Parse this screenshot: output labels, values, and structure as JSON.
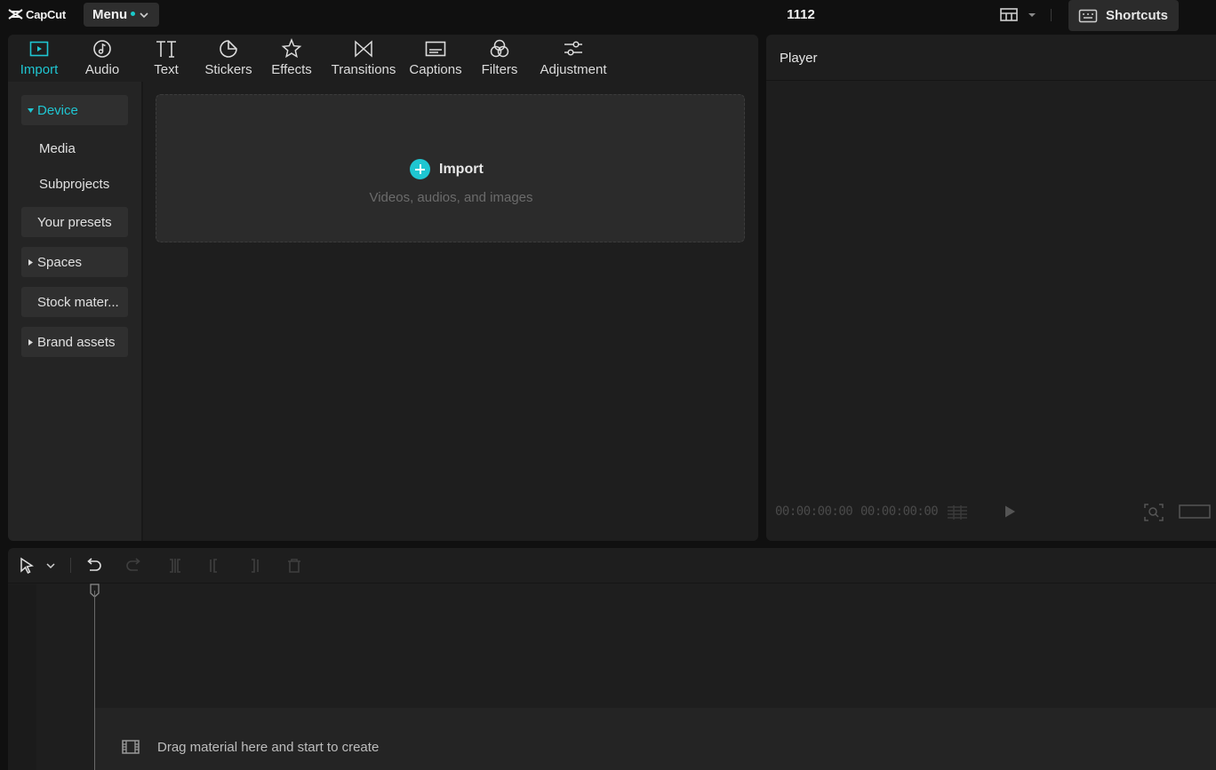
{
  "app": {
    "name": "CapCut",
    "menu_label": "Menu",
    "project_title": "1112",
    "shortcuts_label": "Shortcuts"
  },
  "colors": {
    "accent": "#1fc6d2",
    "background": "#101010",
    "panel": "#1e1e1e"
  },
  "tabs": [
    {
      "label": "Import",
      "icon": "import-icon",
      "active": true
    },
    {
      "label": "Audio",
      "icon": "audio-icon"
    },
    {
      "label": "Text",
      "icon": "text-icon"
    },
    {
      "label": "Stickers",
      "icon": "stickers-icon"
    },
    {
      "label": "Effects",
      "icon": "effects-icon"
    },
    {
      "label": "Transitions",
      "icon": "transitions-icon"
    },
    {
      "label": "Captions",
      "icon": "captions-icon"
    },
    {
      "label": "Filters",
      "icon": "filters-icon"
    },
    {
      "label": "Adjustment",
      "icon": "adjustment-icon"
    }
  ],
  "sidebar": {
    "items": [
      {
        "label": "Device",
        "expanded": true,
        "active": true
      },
      {
        "label": "Media"
      },
      {
        "label": "Subprojects"
      },
      {
        "label": "Your presets"
      },
      {
        "label": "Spaces",
        "expandable": true
      },
      {
        "label": "Stock mater..."
      },
      {
        "label": "Brand assets",
        "expandable": true
      }
    ]
  },
  "import_zone": {
    "title": "Import",
    "subtitle": "Videos, audios, and images"
  },
  "player": {
    "title": "Player",
    "current_time": "00:00:00:00",
    "total_time": "00:00:00:00"
  },
  "timeline": {
    "empty_hint": "Drag material here and start to create"
  }
}
